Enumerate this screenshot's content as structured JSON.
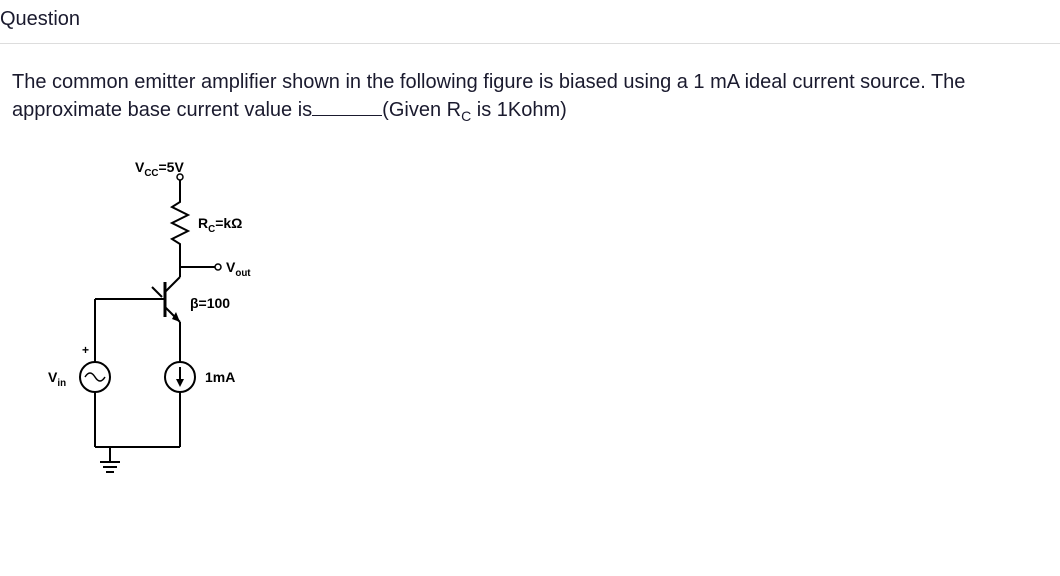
{
  "header": {
    "title": "Question"
  },
  "body": {
    "text_part1": "The common emitter amplifier shown in the following figure is biased using a 1 mA ideal current source. The approximate base current value is",
    "text_part2": "(Given R",
    "text_part2_sub": "C",
    "text_part3": " is 1Kohm)"
  },
  "circuit": {
    "vcc_label": "V",
    "vcc_sub": "CC",
    "vcc_value": "=5V",
    "rc_label": "R",
    "rc_sub": "C",
    "rc_value": "=kΩ",
    "vout_label": "V",
    "vout_sub": "out",
    "beta_label": "β=100",
    "current_label": "1mA",
    "vin_label": "V",
    "vin_sub": "in",
    "plus": "+"
  }
}
